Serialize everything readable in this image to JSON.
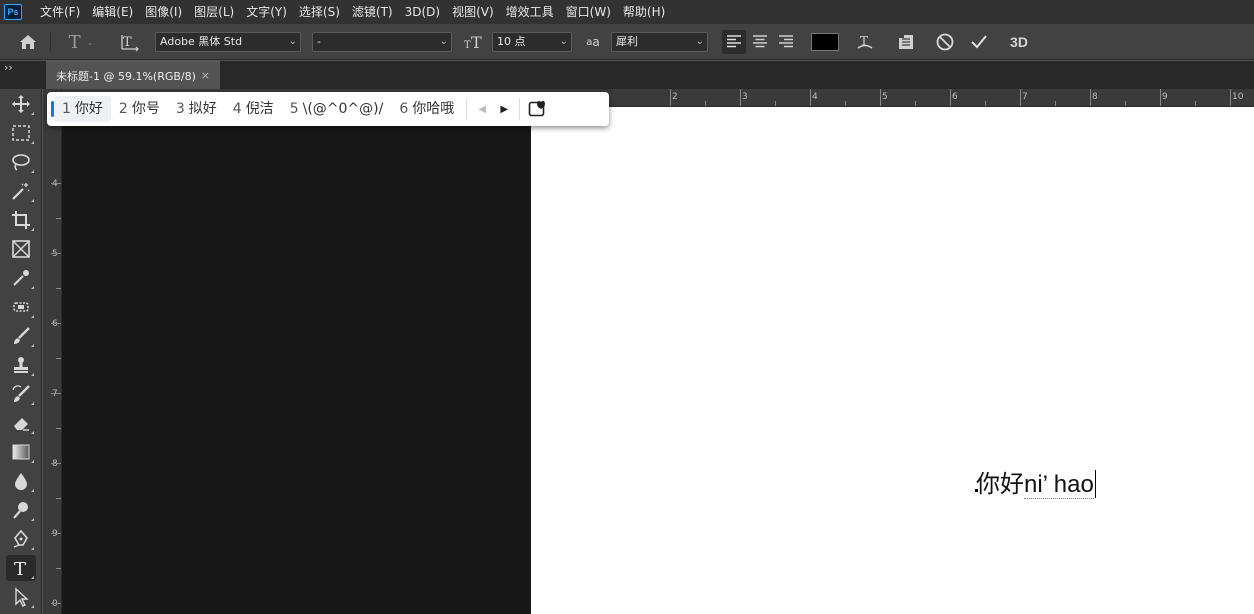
{
  "app": {
    "logo": "Ps"
  },
  "menu": [
    "文件(F)",
    "编辑(E)",
    "图像(I)",
    "图层(L)",
    "文字(Y)",
    "选择(S)",
    "滤镜(T)",
    "3D(D)",
    "视图(V)",
    "增效工具",
    "窗口(W)",
    "帮助(H)"
  ],
  "options": {
    "font_family": "Adobe 黑体 Std",
    "font_style": "-",
    "font_size": "10 点",
    "antialias": "犀利",
    "text_color": "#000000",
    "three_d_label": "3D"
  },
  "tab": {
    "title": "未标题-1 @ 59.1%(RGB/8)",
    "close": "×"
  },
  "ruler": {
    "top": [
      "2",
      "3",
      "4",
      "5",
      "6",
      "7",
      "8",
      "9",
      "10"
    ],
    "left": [
      "4",
      "5",
      "6",
      "7",
      "8",
      "9",
      "0"
    ]
  },
  "ime": {
    "candidates": [
      {
        "num": "1",
        "text": "你好"
      },
      {
        "num": "2",
        "text": "你号"
      },
      {
        "num": "3",
        "text": "拟好"
      },
      {
        "num": "4",
        "text": "倪洁"
      },
      {
        "num": "5",
        "text": "\\(@^0^@)/"
      },
      {
        "num": "6",
        "text": "你哈哦"
      }
    ],
    "accent_color": "#1a73e8"
  },
  "canvas": {
    "committed_text": "你好",
    "composing_text": "ni’ hao"
  }
}
